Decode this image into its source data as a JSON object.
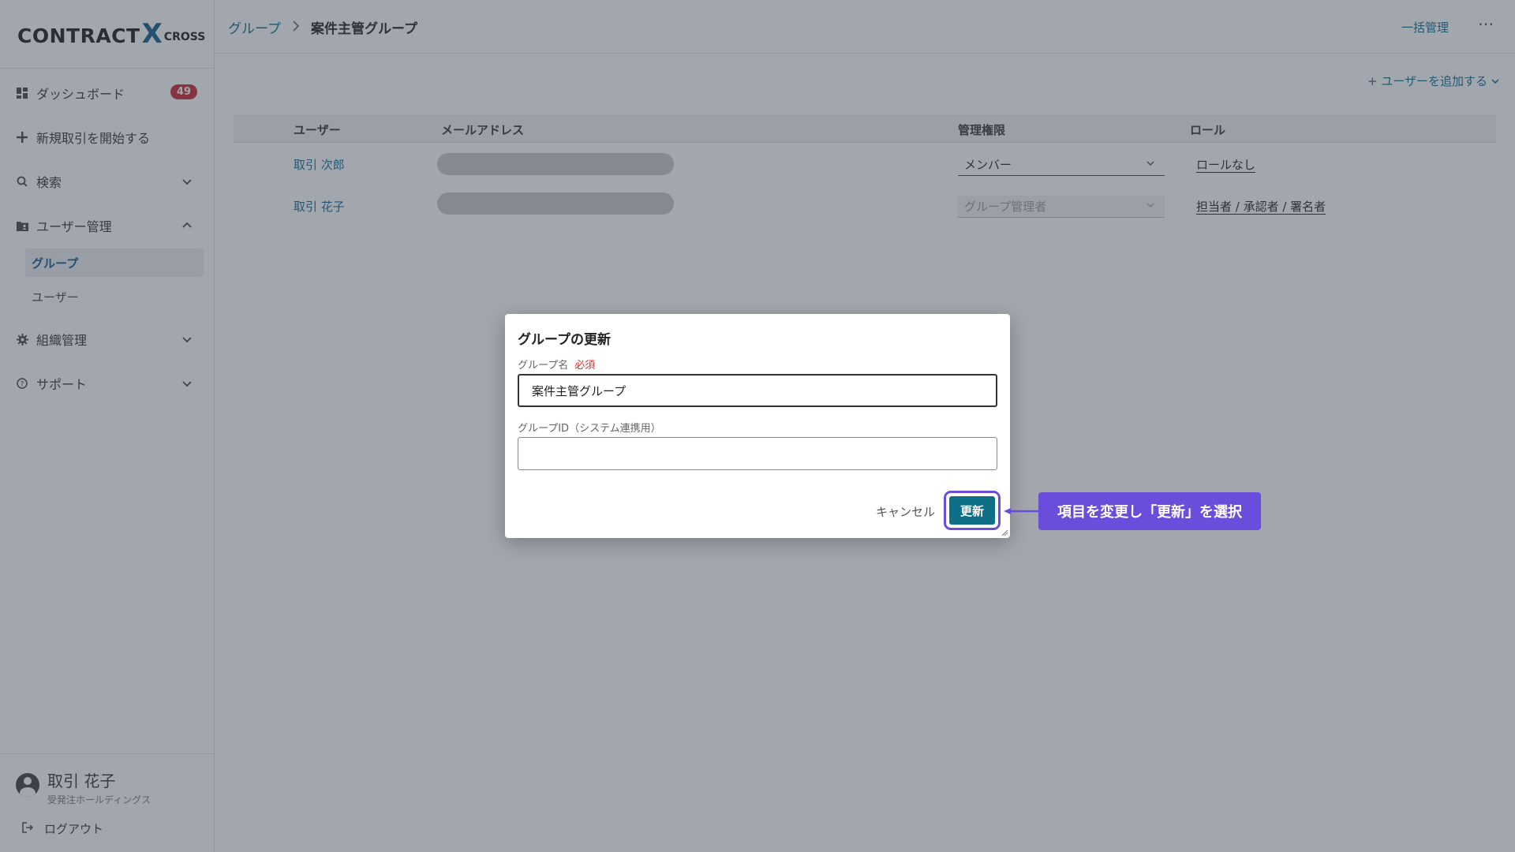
{
  "app": {
    "logo_text": "CONTRACT",
    "logo_x": "X",
    "logo_sub": "CROSS"
  },
  "sidebar": {
    "dashboard": {
      "label": "ダッシュボード",
      "badge": "49"
    },
    "new_deal": {
      "label": "新規取引を開始する"
    },
    "search": {
      "label": "検索"
    },
    "user_mgmt": {
      "label": "ユーザー管理",
      "children": [
        {
          "label": "グループ",
          "active": true
        },
        {
          "label": "ユーザー"
        }
      ]
    },
    "org_mgmt": {
      "label": "組織管理"
    },
    "support": {
      "label": "サポート"
    },
    "account": {
      "name": "取引 花子",
      "org": "受発注ホールディングス"
    },
    "logout": "ログアウト"
  },
  "header": {
    "breadcrumb": [
      "グループ",
      "案件主管グループ"
    ],
    "bulk_manage": "一括管理",
    "more": "⋯"
  },
  "add_user": "+ ユーザーを追加する",
  "table": {
    "columns": [
      "ユーザー",
      "メールアドレス",
      "管理権限",
      "ロール"
    ],
    "rows": [
      {
        "name": "取引 次郎",
        "permission": "メンバー",
        "role": "ロールなし",
        "disabled": false
      },
      {
        "name": "取引 花子",
        "permission": "グループ管理者",
        "role": "担当者 / 承認者 / 署名者",
        "disabled": true
      }
    ]
  },
  "modal": {
    "title": "グループの更新",
    "group_name_label": "グループ名",
    "required": "必須",
    "group_name_value": "案件主管グループ",
    "group_id_label": "グループID（システム連携用）",
    "group_id_value": "",
    "cancel": "キャンセル",
    "update": "更新"
  },
  "callout": "項目を変更し「更新」を選択",
  "colors": {
    "accent": "#0f6f86",
    "link": "#0f6b8e",
    "badge": "#c9252c",
    "highlight": "#6a4ddb"
  }
}
